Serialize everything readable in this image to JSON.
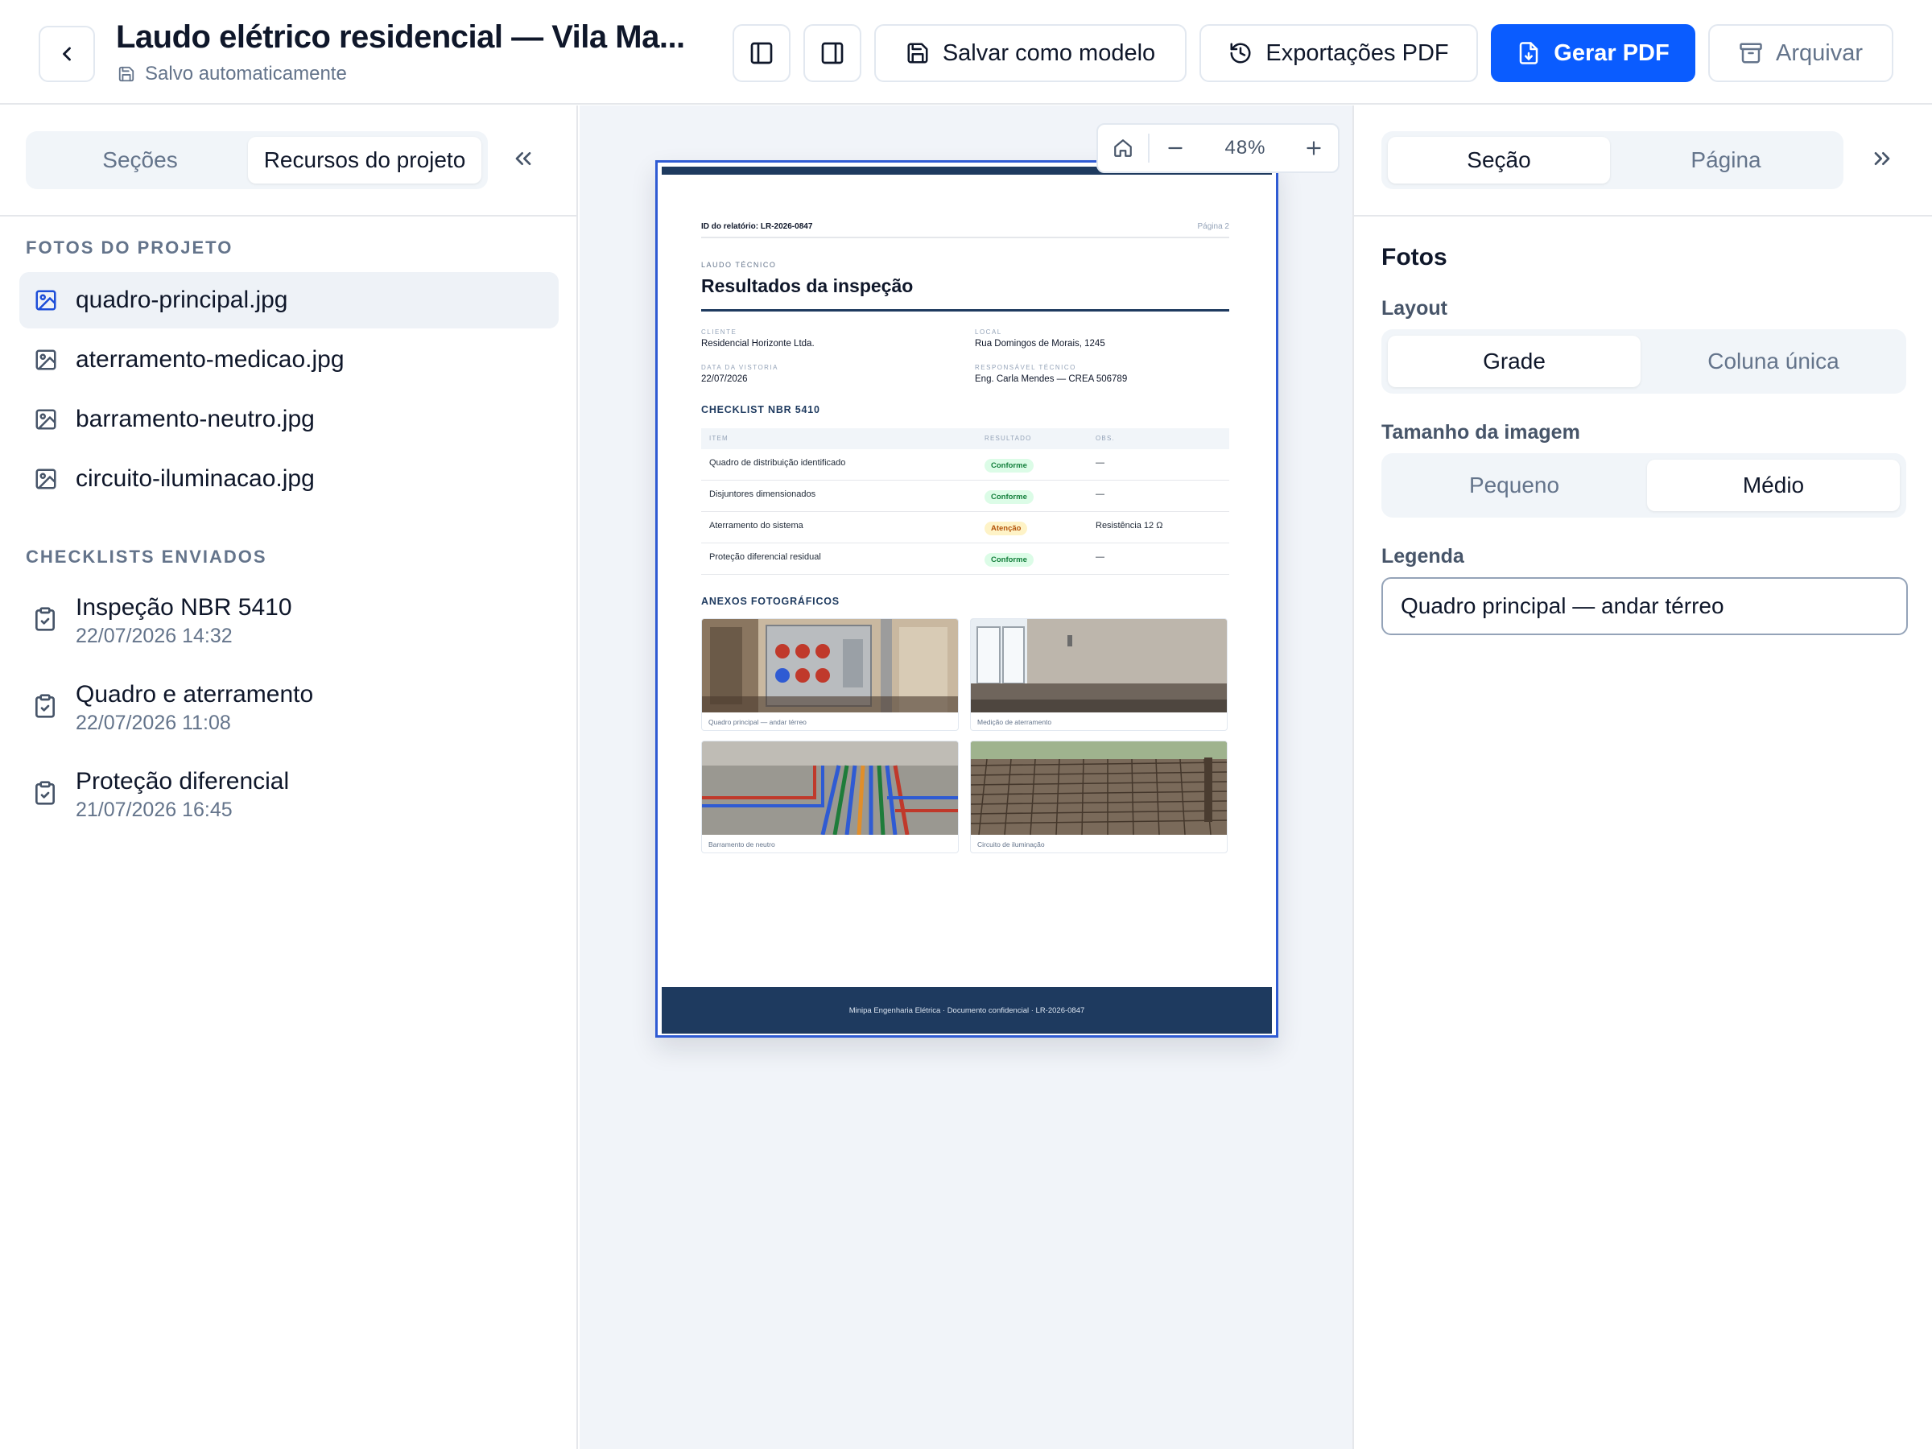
{
  "header": {
    "title": "Laudo elétrico residencial — Vila Ma...",
    "saved_status": "Salvo automaticamente",
    "buttons": {
      "save_template": "Salvar como modelo",
      "pdf_exports": "Exportações PDF",
      "generate_pdf": "Gerar PDF",
      "archive": "Arquivar"
    }
  },
  "left_panel": {
    "tabs": [
      "Seções",
      "Recursos do projeto"
    ],
    "active_tab": "Recursos do projeto",
    "photos_title": "FOTOS DO PROJETO",
    "photos": [
      "quadro-principal.jpg",
      "aterramento-medicao.jpg",
      "barramento-neutro.jpg",
      "circuito-iluminacao.jpg"
    ],
    "selected_photo": "quadro-principal.jpg",
    "checklists_title": "CHECKLISTS ENVIADOS",
    "checklists": [
      {
        "title": "Inspeção NBR 5410",
        "time": "22/07/2026 14:32"
      },
      {
        "title": "Quadro e aterramento",
        "time": "22/07/2026 11:08"
      },
      {
        "title": "Proteção diferencial",
        "time": "21/07/2026 16:45"
      }
    ]
  },
  "zoom": {
    "level": "48%"
  },
  "document": {
    "report_id": "ID do relatório: LR-2026-0847",
    "page_label": "Página 2",
    "kicker": "LAUDO TÉCNICO",
    "heading": "Resultados da inspeção",
    "client_label": "CLIENTE",
    "client": "Residencial Horizonte Ltda.",
    "location_label": "LOCAL",
    "location": "Rua Domingos de Morais, 1245",
    "date_label": "DATA DA VISTORIA",
    "date": "22/07/2026",
    "responsible_label": "RESPONSÁVEL TÉCNICO",
    "responsible": "Eng. Carla Mendes — CREA 506789",
    "checklist_title": "CHECKLIST NBR 5410",
    "table_headers": [
      "ITEM",
      "RESULTADO",
      "OBS."
    ],
    "rows": [
      {
        "item": "Quadro de distribuição identificado",
        "result": "Conforme",
        "obs": "—"
      },
      {
        "item": "Disjuntores dimensionados",
        "result": "Conforme",
        "obs": "—"
      },
      {
        "item": "Aterramento do sistema",
        "result": "Atenção",
        "obs": "Resistência 12 Ω"
      },
      {
        "item": "Proteção diferencial residual",
        "result": "Conforme",
        "obs": "—"
      }
    ],
    "photos_title": "ANEXOS FOTOGRÁFICOS",
    "photo_captions": [
      "Quadro principal — andar térreo",
      "Medição de aterramento",
      "Barramento de neutro",
      "Circuito de iluminação"
    ],
    "footer": "Minipa Engenharia Elétrica · Documento confidencial · LR-2026-0847"
  },
  "right_panel": {
    "tabs": [
      "Seção",
      "Página"
    ],
    "active_tab": "Seção",
    "heading": "Fotos",
    "layout_label": "Layout",
    "layout_options": [
      "Grade",
      "Coluna única"
    ],
    "layout_selected": "Grade",
    "size_label": "Tamanho da imagem",
    "size_options": [
      "Pequeno",
      "Médio"
    ],
    "size_selected": "Médio",
    "caption_label": "Legenda",
    "caption_value": "Quadro principal — andar térreo"
  },
  "colors": {
    "accent": "#0a5cff",
    "navy": "#1e3a5f",
    "ok_bg": "#dcfce7",
    "warn_bg": "#fef3c7"
  },
  "icons": [
    "chevron-left-icon",
    "save-icon",
    "panel-left-icon",
    "panel-right-icon",
    "history-icon",
    "file-download-icon",
    "archive-icon",
    "chevrons-left-icon",
    "chevrons-right-icon",
    "image-icon",
    "clipboard-check-icon",
    "home-icon",
    "minus-icon",
    "plus-icon"
  ]
}
